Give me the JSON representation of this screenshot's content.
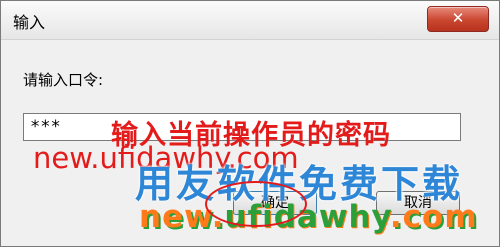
{
  "window": {
    "title": "输入"
  },
  "form": {
    "prompt": "请输入口令:",
    "password_value": "***"
  },
  "buttons": {
    "ok_label": "确定",
    "cancel_label": "取消",
    "close_symbol": "✕"
  },
  "overlay": {
    "hint_text": "输入当前操作员的密码",
    "watermark_url_top": "new.ufidawhy.com",
    "watermark_slogan": "用友软件免费下载",
    "watermark_url_bottom_a": "new.",
    "watermark_url_bottom_b": "ufidawhy",
    "watermark_url_bottom_c": ".com"
  },
  "colors": {
    "annotation_red": "#e31b1b",
    "slogan_blue": "#2d86d6",
    "url_orange": "#ff7a1a",
    "url_green": "#2a9f3a"
  }
}
